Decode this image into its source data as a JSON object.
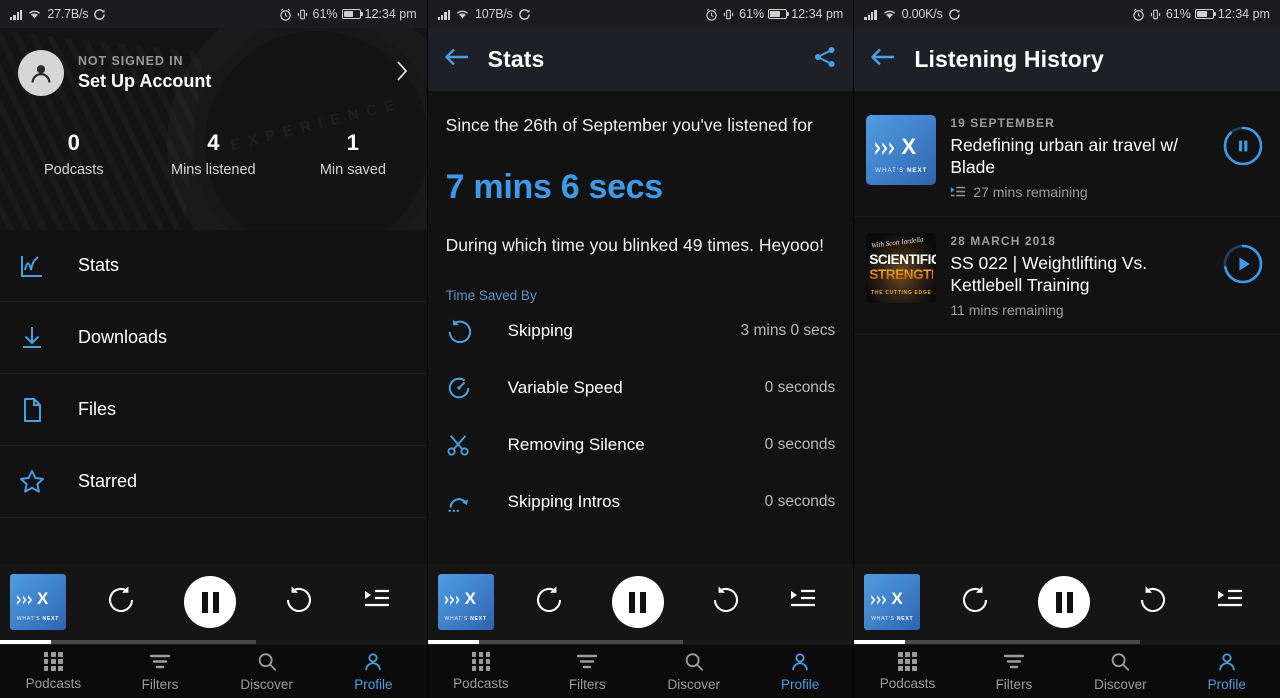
{
  "app": {
    "accent": "#3d9ae8",
    "bg": "#121212",
    "appbar_bg": "#1e2027"
  },
  "panels": [
    {
      "id": "profile",
      "statusbar": {
        "net_speed": "27.7B/s",
        "battery_pct": "61%",
        "time": "12:34 pm"
      },
      "account": {
        "subtitle": "NOT SIGNED IN",
        "title": "Set Up Account"
      },
      "stats": [
        {
          "value": "0",
          "label": "Podcasts"
        },
        {
          "value": "4",
          "label": "Mins listened"
        },
        {
          "value": "1",
          "label": "Min  saved"
        }
      ],
      "menu": [
        {
          "label": "Stats",
          "icon": "chart-icon"
        },
        {
          "label": "Downloads",
          "icon": "download-icon"
        },
        {
          "label": "Files",
          "icon": "file-icon"
        },
        {
          "label": "Starred",
          "icon": "star-icon"
        }
      ]
    },
    {
      "id": "stats",
      "statusbar": {
        "net_speed": "107B/s",
        "battery_pct": "61%",
        "time": "12:34 pm"
      },
      "header": {
        "title": "Stats",
        "back": "back-arrow-icon",
        "action": "share-icon"
      },
      "lead": "Since the 26th of September you've listened for",
      "big": "7 mins 6 secs",
      "blink": "During which time you blinked 49 times. Heyooo!",
      "saved_title": "Time Saved By",
      "saved_rows": [
        {
          "icon": "skip-forward-icon",
          "label": "Skipping",
          "value": "3 mins 0 secs"
        },
        {
          "icon": "speedometer-icon",
          "label": "Variable Speed",
          "value": "0 seconds"
        },
        {
          "icon": "scissors-icon",
          "label": "Removing Silence",
          "value": "0 seconds"
        },
        {
          "icon": "skip-intro-icon",
          "label": "Skipping Intros",
          "value": "0 seconds"
        }
      ]
    },
    {
      "id": "history",
      "statusbar": {
        "net_speed": "0.00K/s",
        "battery_pct": "61%",
        "time": "12:34 pm"
      },
      "header": {
        "title": "Listening History",
        "back": "back-arrow-icon"
      },
      "rows": [
        {
          "date": "19 SEPTEMBER",
          "title": "Redefining urban air travel w/ Blade",
          "remaining": "27 mins remaining",
          "state": "pause",
          "progress_pct": 88,
          "artwork": {
            "kind": "whatsnext",
            "line1": "WHAT'S",
            "line2": "NEXT"
          }
        },
        {
          "date": "28 MARCH 2018",
          "title": "SS 022 | Weightlifting Vs. Kettlebell Training",
          "remaining": "11 mins remaining",
          "state": "play",
          "progress_pct": 72,
          "artwork": {
            "kind": "scientific",
            "script": "With Scott Iardella",
            "t1": "SCIENTIFIC",
            "t2": "STRENGTH",
            "t3": "THE CUTTING EDGE"
          }
        }
      ]
    }
  ],
  "miniplayer": {
    "artwork": {
      "line1": "WHAT'S",
      "line2": "NEXT"
    },
    "skip_back": "skip-back-15-icon",
    "play_state": "pause",
    "skip_forward": "skip-forward-30-icon",
    "queue": "queue-icon",
    "progress": {
      "position_pct": 12,
      "buffer_pct": 60
    }
  },
  "bottomnav": {
    "items": [
      {
        "label": "Podcasts",
        "icon": "grid-icon",
        "active": false
      },
      {
        "label": "Filters",
        "icon": "filter-icon",
        "active": false
      },
      {
        "label": "Discover",
        "icon": "search-icon",
        "active": false
      },
      {
        "label": "Profile",
        "icon": "person-icon",
        "active": true
      }
    ]
  }
}
